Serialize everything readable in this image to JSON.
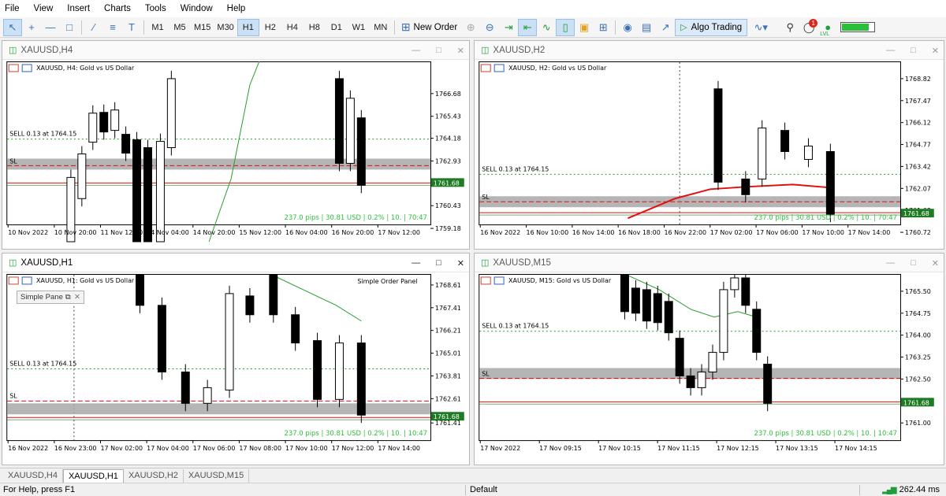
{
  "menu": [
    "File",
    "View",
    "Insert",
    "Charts",
    "Tools",
    "Window",
    "Help"
  ],
  "toolbar": {
    "timeframes": [
      "M1",
      "M5",
      "M15",
      "M30",
      "H1",
      "H2",
      "H4",
      "H8",
      "D1",
      "W1",
      "MN"
    ],
    "active_timeframe": "H1",
    "new_order_label": "New Order",
    "algo_trading_label": "Algo Trading",
    "notification_count": "1",
    "level_label": "LVL",
    "level_fill": 0.85,
    "icons": [
      "cursor-icon",
      "crosshair-icon",
      "line-icon",
      "period-separator-icon",
      "trendline-icon",
      "fibonacci-icon",
      "text-icon",
      "zoom-in-icon",
      "zoom-out-icon",
      "autoscroll-icon",
      "chart-shift-icon",
      "line-chart-icon",
      "candles-icon",
      "templates-icon",
      "tile-windows-icon",
      "screenshot-icon",
      "market-icon",
      "fullscreen-icon",
      "indicators-icon",
      "search-icon",
      "notifications-icon"
    ]
  },
  "colors": {
    "accent": "#3b6fb6",
    "bid_label": "#1e7a23",
    "grid_dashed": "#2a9d2a",
    "sl_band": "#a8a8a8",
    "red_line": "#e01010",
    "stat_text": "#2cbf3a"
  },
  "windows": [
    {
      "title": "XAUUSD,H4",
      "chart_title": "XAUUSD, H4:  Gold vs US Dollar",
      "sell_label": "SELL 0.13 at 1764.15",
      "sl_label": "SL",
      "bid": "1761.68",
      "price_ticks": [
        "1766.68",
        "1765.43",
        "1764.18",
        "1762.93",
        "1761.68",
        "1760.43",
        "1759.18"
      ],
      "time_ticks": [
        "10 Nov 2022",
        "10 Nov 20:00",
        "11 Nov 12:00",
        "14 Nov 04:00",
        "14 Nov 20:00",
        "15 Nov 12:00",
        "16 Nov 04:00",
        "16 Nov 20:00",
        "17 Nov 12:00"
      ],
      "stats": "237.0 pips | 30.81 USD | 0.2% | 10. | 70:47"
    },
    {
      "title": "XAUUSD,H2",
      "chart_title": "XAUUSD, H2:  Gold vs US Dollar",
      "sell_label": "SELL 0.13 at 1764.15",
      "sl_label": "SL",
      "bid": "1761.68",
      "price_ticks": [
        "1768.82",
        "1767.47",
        "1766.12",
        "1764.77",
        "1763.42",
        "1762.07",
        "1761.68",
        "1760.72"
      ],
      "time_ticks": [
        "16 Nov 2022",
        "16 Nov 10:00",
        "16 Nov 14:00",
        "16 Nov 18:00",
        "16 Nov 22:00",
        "17 Nov 02:00",
        "17 Nov 06:00",
        "17 Nov 10:00",
        "17 Nov 14:00"
      ],
      "stats": "237.0 pips | 30.81 USD | 0.2% | 10. | 70:47"
    },
    {
      "title": "XAUUSD,H1",
      "chart_title": "XAUUSD, H1:  Gold vs US Dollar",
      "panel_label": "Simple Order Panel",
      "simple_panel_label": "Simple Pane",
      "sell_label": "SELL 0.13 at 1764.15",
      "sl_label": "SL",
      "bid": "1761.68",
      "price_ticks": [
        "1768.61",
        "1767.41",
        "1766.21",
        "1765.01",
        "1763.81",
        "1762.61",
        "1761.68",
        "1761.41"
      ],
      "time_ticks": [
        "16 Nov 2022",
        "16 Nov 23:00",
        "17 Nov 02:00",
        "17 Nov 04:00",
        "17 Nov 06:00",
        "17 Nov 08:00",
        "17 Nov 10:00",
        "17 Nov 12:00",
        "17 Nov 14:00"
      ],
      "stats": "237.0 pips | 30.81 USD | 0.2% | 10. | 10:47"
    },
    {
      "title": "XAUUSD,M15",
      "chart_title": "XAUUSD, M15:  Gold vs US Dollar",
      "sell_label": "SELL 0.13 at 1764.15",
      "sl_label": "SL",
      "bid": "1761.68",
      "price_ticks": [
        "1765.50",
        "1764.75",
        "1764.00",
        "1763.25",
        "1762.50",
        "1761.68",
        "1761.00"
      ],
      "time_ticks": [
        "17 Nov 2022",
        "17 Nov 09:15",
        "17 Nov 10:15",
        "17 Nov 11:15",
        "17 Nov 12:15",
        "17 Nov 13:15",
        "17 Nov 14:15"
      ],
      "stats": "237.0 pips | 30.81 USD | 0.2% | 10. | 10:47"
    }
  ],
  "tabs": [
    "XAUUSD,H4",
    "XAUUSD,H1",
    "XAUUSD,H2",
    "XAUUSD,M15"
  ],
  "active_tab": "XAUUSD,H1",
  "status": {
    "help": "For Help, press F1",
    "profile": "Default",
    "ping": "262.44 ms"
  }
}
